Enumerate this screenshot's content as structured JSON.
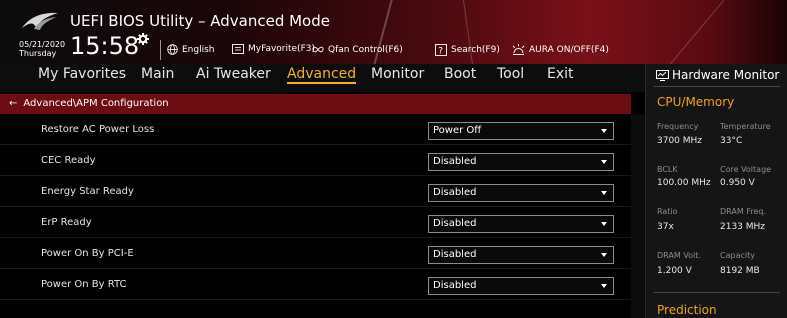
{
  "header": {
    "title": "UEFI BIOS Utility – Advanced Mode",
    "date": "05/21/2020",
    "day": "Thursday",
    "time": "15:58",
    "tools": [
      {
        "icon": "globe-icon",
        "label": "English"
      },
      {
        "icon": "myfavorite-icon",
        "label": "MyFavorite(F3)"
      },
      {
        "icon": "fan-icon",
        "label": "Qfan Control(F6)"
      },
      {
        "icon": "search-help-icon",
        "label": "Search(F9)"
      },
      {
        "icon": "aura-icon",
        "label": "AURA ON/OFF(F4)"
      }
    ]
  },
  "nav": {
    "items": [
      "My Favorites",
      "Main",
      "Ai Tweaker",
      "Advanced",
      "Monitor",
      "Boot",
      "Tool",
      "Exit"
    ],
    "active": "Advanced"
  },
  "breadcrumb": "Advanced\\APM Configuration",
  "settings": [
    {
      "label": "Restore AC Power Loss",
      "value": "Power Off"
    },
    {
      "label": "CEC Ready",
      "value": "Disabled"
    },
    {
      "label": "Energy Star Ready",
      "value": "Disabled"
    },
    {
      "label": "ErP Ready",
      "value": "Disabled"
    },
    {
      "label": "Power On By PCI-E",
      "value": "Disabled"
    },
    {
      "label": "Power On By RTC",
      "value": "Disabled"
    }
  ],
  "hardware_monitor": {
    "title": "Hardware Monitor",
    "section": "CPU/Memory",
    "stats": [
      {
        "label": "Frequency",
        "value": "3700 MHz"
      },
      {
        "label": "Temperature",
        "value": "33°C"
      },
      {
        "label": "BCLK",
        "value": "100.00 MHz"
      },
      {
        "label": "Core Voltage",
        "value": "0.950 V"
      },
      {
        "label": "Ratio",
        "value": "37x"
      },
      {
        "label": "DRAM Freq.",
        "value": "2133 MHz"
      },
      {
        "label": "DRAM Volt.",
        "value": "1.200 V"
      },
      {
        "label": "Capacity",
        "value": "8192 MB"
      }
    ],
    "prediction": "Prediction"
  },
  "colors": {
    "accent": "#f0b21a",
    "breadcrumb_bg": "#6b0d12",
    "section_orange": "#f0a020"
  }
}
